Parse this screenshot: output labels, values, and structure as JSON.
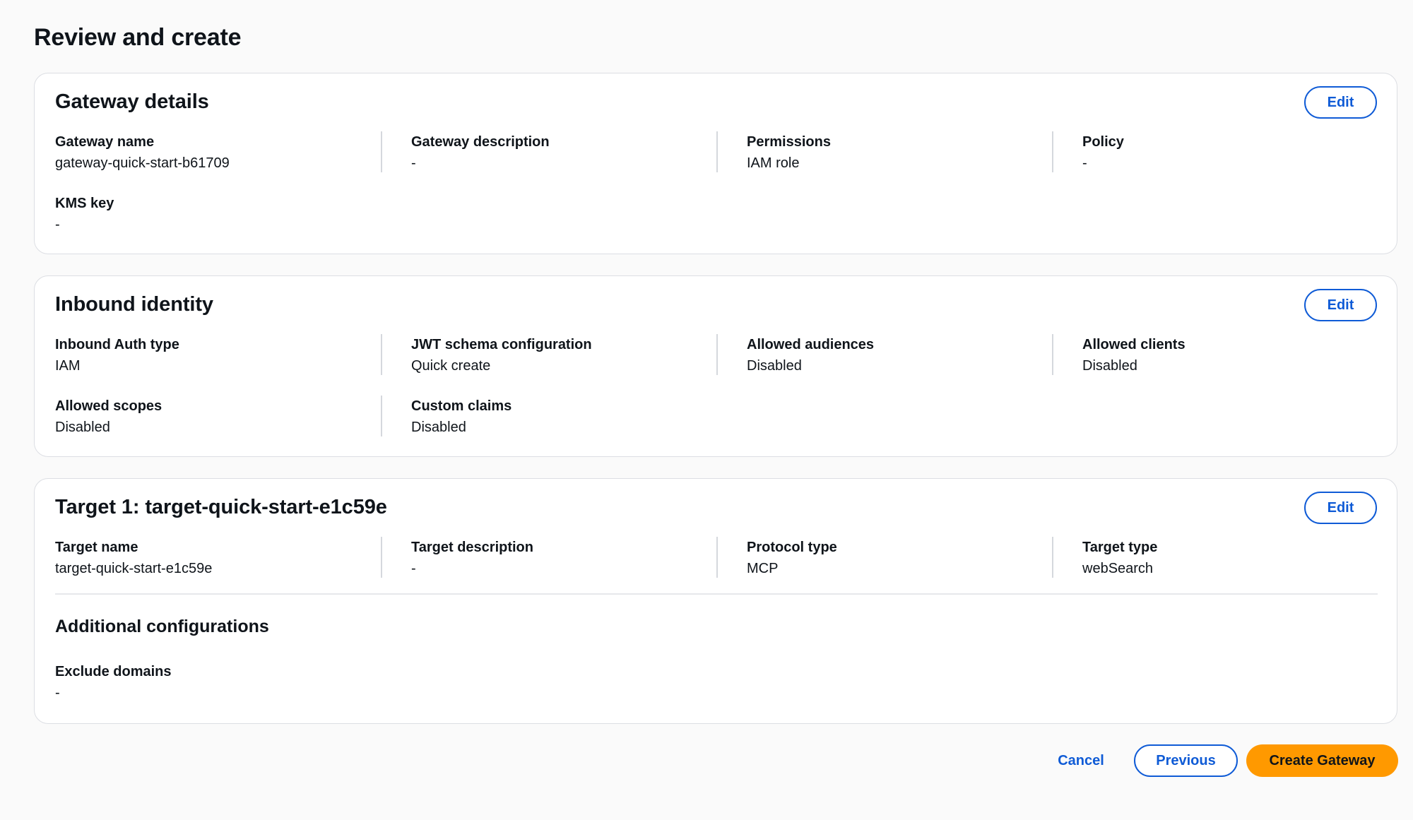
{
  "page": {
    "title": "Review and create"
  },
  "gateway_details": {
    "title": "Gateway details",
    "edit_label": "Edit",
    "fields": [
      {
        "label": "Gateway name",
        "value": "gateway-quick-start-b61709"
      },
      {
        "label": "Gateway description",
        "value": "-"
      },
      {
        "label": "Permissions",
        "value": "IAM role"
      },
      {
        "label": "Policy",
        "value": "-"
      },
      {
        "label": "KMS key",
        "value": "-"
      }
    ]
  },
  "inbound_identity": {
    "title": "Inbound identity",
    "edit_label": "Edit",
    "fields": [
      {
        "label": "Inbound Auth type",
        "value": "IAM"
      },
      {
        "label": "JWT schema configuration",
        "value": "Quick create"
      },
      {
        "label": "Allowed audiences",
        "value": "Disabled"
      },
      {
        "label": "Allowed clients",
        "value": "Disabled"
      },
      {
        "label": "Allowed scopes",
        "value": "Disabled"
      },
      {
        "label": "Custom claims",
        "value": "Disabled"
      }
    ]
  },
  "target": {
    "title": "Target 1: target-quick-start-e1c59e",
    "edit_label": "Edit",
    "fields": [
      {
        "label": "Target name",
        "value": "target-quick-start-e1c59e"
      },
      {
        "label": "Target description",
        "value": "-"
      },
      {
        "label": "Protocol type",
        "value": "MCP"
      },
      {
        "label": "Target type",
        "value": "webSearch"
      }
    ],
    "additional": {
      "title": "Additional configurations",
      "fields": [
        {
          "label": "Exclude domains",
          "value": "-"
        }
      ]
    }
  },
  "footer": {
    "cancel_label": "Cancel",
    "previous_label": "Previous",
    "create_label": "Create Gateway"
  }
}
